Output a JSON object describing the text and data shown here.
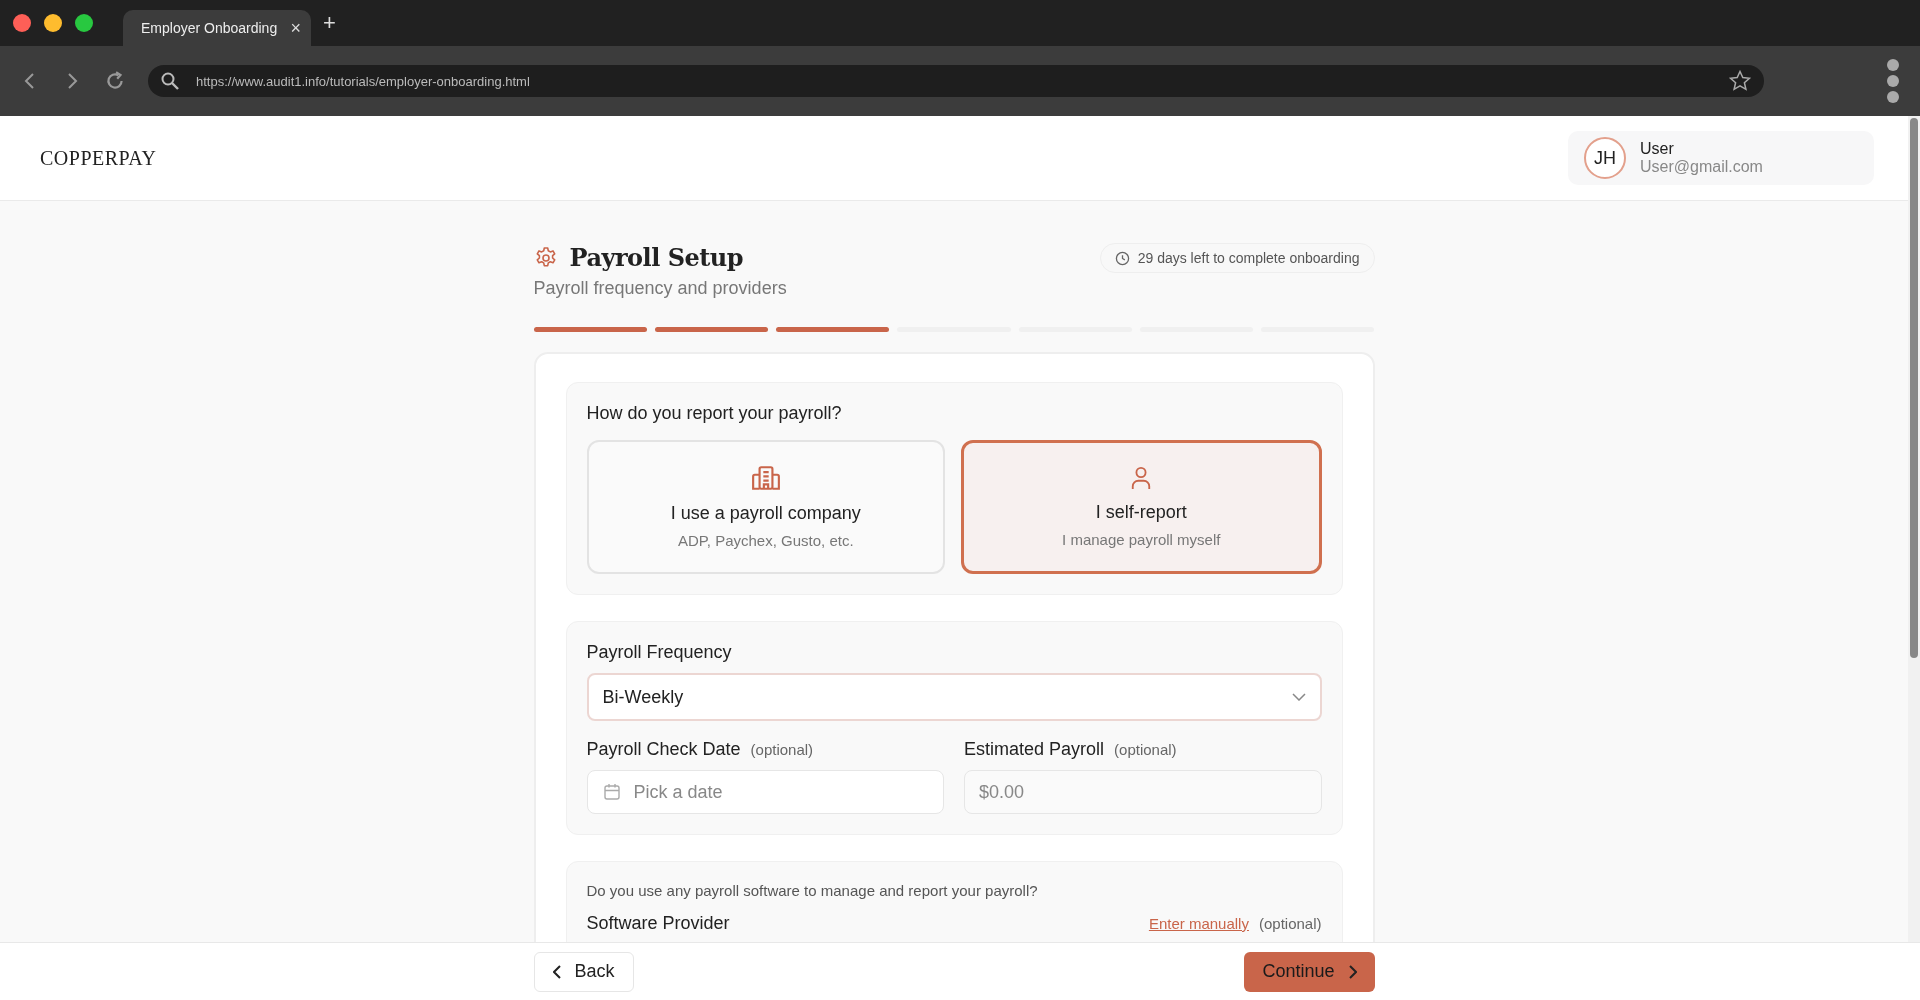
{
  "browser": {
    "tab": {
      "title": "Employer Onboarding",
      "close": "×"
    },
    "new_tab": "+",
    "url": "https://www.audit1.info/tutorials/employer-onboarding.html"
  },
  "header": {
    "logo": "COPPERPAY",
    "user": {
      "initials": "JH",
      "name": "User",
      "email": "User@gmail.com"
    }
  },
  "page": {
    "title": "Payroll Setup",
    "subtitle": "Payroll frequency and providers",
    "deadline": "29 days left to complete onboarding"
  },
  "progress": [
    {
      "done": true
    },
    {
      "done": true
    },
    {
      "done": true
    },
    {
      "done": false
    },
    {
      "done": false
    },
    {
      "done": false
    },
    {
      "done": false
    }
  ],
  "report_method": {
    "question": "How do you report your payroll?",
    "options": [
      {
        "kind": "company",
        "title": "I use a payroll company",
        "description": "ADP, Paychex, Gusto, etc.",
        "selected": false
      },
      {
        "kind": "self",
        "title": "I self-report",
        "description": "I manage payroll myself",
        "selected": true
      }
    ]
  },
  "frequency": {
    "label": "Payroll Frequency",
    "value": "Bi-Weekly"
  },
  "check_date": {
    "label": "Payroll Check Date",
    "hint": "(optional)",
    "placeholder": "Pick a date"
  },
  "estimated_payroll": {
    "label": "Estimated Payroll",
    "hint": "(optional)",
    "placeholder": "$0.00"
  },
  "software": {
    "question": "Do you use any payroll software to manage and report your payroll?",
    "label": "Software Provider",
    "link": "Enter manually",
    "hint": "(optional)"
  },
  "footer": {
    "back": "Back",
    "continue": "Continue"
  }
}
